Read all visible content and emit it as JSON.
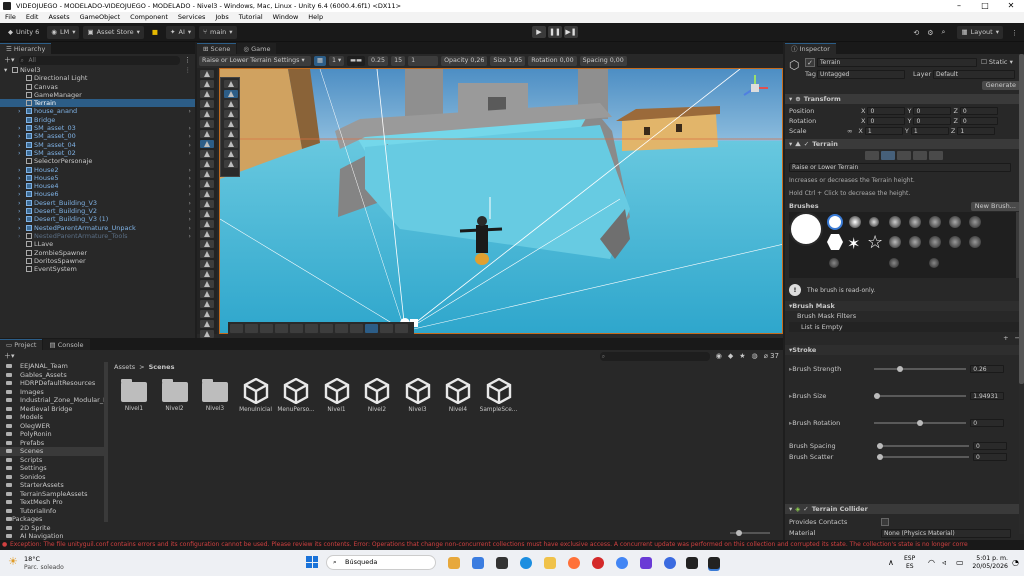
{
  "window": {
    "title": "VIDEOJUEGO - MODELADO-VIDEOJUEGO - MODELADO - Nivel3 - Windows, Mac, Linux - Unity 6.4 (6000.4.6f1) <DX11>"
  },
  "menu": [
    "File",
    "Edit",
    "Assets",
    "GameObject",
    "Component",
    "Services",
    "Jobs",
    "Tutorial",
    "Window",
    "Help"
  ],
  "toolbar": {
    "unity": "Unity 6",
    "account": "LM",
    "asset_store": "Asset Store",
    "ai": "AI",
    "branch": "main",
    "layout": "Layout"
  },
  "hierarchy": {
    "tab": "Hierarchy",
    "search_placeholder": "All",
    "scene_name": "Nivel3",
    "items": [
      {
        "label": "Directional Light",
        "kind": "normal",
        "indent": 2
      },
      {
        "label": "Canvas",
        "kind": "normal",
        "indent": 2
      },
      {
        "label": "GameManager",
        "kind": "normal",
        "indent": 2
      },
      {
        "label": "Terrain",
        "kind": "selected",
        "indent": 2
      },
      {
        "label": "house_anand",
        "kind": "blue",
        "indent": 2,
        "chev": true
      },
      {
        "label": "Bridge",
        "kind": "blue",
        "indent": 2
      },
      {
        "label": "SM_asset_03",
        "kind": "blue",
        "indent": 2,
        "chev": true
      },
      {
        "label": "SM_asset_00",
        "kind": "blue",
        "indent": 2,
        "chev": true
      },
      {
        "label": "SM_asset_04",
        "kind": "blue",
        "indent": 2,
        "chev": true
      },
      {
        "label": "SM_asset_02",
        "kind": "blue",
        "indent": 2,
        "chev": true
      },
      {
        "label": "SelectorPersonaje",
        "kind": "normal",
        "indent": 2
      },
      {
        "label": "House2",
        "kind": "blue",
        "indent": 2,
        "chev": true
      },
      {
        "label": "House5",
        "kind": "blue",
        "indent": 2,
        "chev": true
      },
      {
        "label": "House4",
        "kind": "blue",
        "indent": 2,
        "chev": true
      },
      {
        "label": "House6",
        "kind": "blue",
        "indent": 2,
        "chev": true
      },
      {
        "label": "Desert_Building_V3",
        "kind": "blue",
        "indent": 2,
        "chev": true
      },
      {
        "label": "Desert_Building_V2",
        "kind": "blue",
        "indent": 2,
        "chev": true
      },
      {
        "label": "Desert_Building_V3 (1)",
        "kind": "blue",
        "indent": 2,
        "chev": true
      },
      {
        "label": "NestedParentArmature_Unpack",
        "kind": "blue",
        "indent": 2,
        "chev": true
      },
      {
        "label": "NestedParentArmature_Tools",
        "kind": "faded",
        "indent": 2,
        "chev": true
      },
      {
        "label": "LLave",
        "kind": "normal",
        "indent": 2
      },
      {
        "label": "ZombieSpawner",
        "kind": "normal",
        "indent": 2
      },
      {
        "label": "DoritosSpawner",
        "kind": "normal",
        "indent": 2
      },
      {
        "label": "EventSystem",
        "kind": "normal",
        "indent": 2
      }
    ]
  },
  "scene": {
    "tabs": [
      "Scene",
      "Game"
    ],
    "mode": "Raise or Lower Terrain Settings",
    "layer_value": "1",
    "field1": "0.25",
    "field2": "15",
    "field3": "1",
    "opacity": "Opacity 0,26",
    "size": "Size 1,95",
    "rotation": "Rotation 0,00",
    "spacing": "Spacing 0,00"
  },
  "project": {
    "tabs": [
      "Project",
      "Console"
    ],
    "breadcrumb": [
      "Assets",
      "Scenes"
    ],
    "count": "37",
    "folders": [
      "EEJANAL_Team",
      "Gables_Assets",
      "HDRPDefaultResources",
      "Images",
      "Industrial_Zone_Modular_I",
      "Medieval Bridge",
      "Models",
      "OlegWER",
      "PolyRonin",
      "Prefabs",
      "Scenes",
      "Scripts",
      "Settings",
      "Sonidos",
      "StarterAssets",
      "TerrainSampleAssets",
      "TextMesh Pro",
      "TutorialInfo"
    ],
    "packages_label": "Packages",
    "packages": [
      "2D Sprite",
      "AI Navigation"
    ],
    "assets": [
      {
        "label": "Nivel1",
        "type": "folder"
      },
      {
        "label": "Nivel2",
        "type": "folder"
      },
      {
        "label": "Nivel3",
        "type": "folder"
      },
      {
        "label": "MenuInicial",
        "type": "unity"
      },
      {
        "label": "MenuPerso...",
        "type": "unity"
      },
      {
        "label": "Nivel1",
        "type": "unity"
      },
      {
        "label": "Nivel2",
        "type": "unity"
      },
      {
        "label": "Nivel3",
        "type": "unity"
      },
      {
        "label": "Nivel4",
        "type": "unity"
      },
      {
        "label": "SampleSce...",
        "type": "unity"
      }
    ]
  },
  "inspector": {
    "tab": "Inspector",
    "object_name": "Terrain",
    "static_label": "Static",
    "tag_label": "Tag",
    "tag_value": "Untagged",
    "layer_label": "Layer",
    "layer_value": "Default",
    "generate": "Generate",
    "transform": {
      "title": "Transform",
      "position_label": "Position",
      "rotation_label": "Rotation",
      "scale_label": "Scale",
      "position": [
        "0",
        "0",
        "0"
      ],
      "rotation": [
        "0",
        "0",
        "0"
      ],
      "scale": [
        "1",
        "1",
        "1"
      ]
    },
    "terrain": {
      "title": "Terrain",
      "tool": "Raise or Lower Terrain",
      "help1": "Increases or decreases the Terrain height.",
      "help2": "Hold Ctrl + Click to decrease the height.",
      "brushes_label": "Brushes",
      "new_brush": "New Brush...",
      "readonly": "The brush is read-only.",
      "brush_mask": "Brush Mask",
      "brush_mask_filters": "Brush Mask Filters",
      "list_empty": "List is Empty",
      "stroke": "Stroke",
      "brush_strength_label": "Brush Strength",
      "brush_strength": "0.26",
      "brush_size_label": "Brush Size",
      "brush_size": "1.94931",
      "brush_rotation_label": "Brush Rotation",
      "brush_rotation": "0",
      "brush_spacing_label": "Brush Spacing",
      "brush_spacing": "0",
      "brush_scatter_label": "Brush Scatter",
      "brush_scatter": "0"
    },
    "collider": {
      "title": "Terrain Collider",
      "provides_contacts": "Provides Contacts",
      "material_label": "Material",
      "material_value": "None (Physics Material)"
    }
  },
  "status": {
    "message": "Exception: The file unityguil.conf contains errors and its configuration cannot be used. Please review its contents. Error: Operations that change non-concurrent collections must have exclusive access. A concurrent update was performed on this collection and corrupted its state. The collection's state is no longer corre"
  },
  "taskbar": {
    "temp": "18°C",
    "weather": "Parc. soleado",
    "search": "Búsqueda",
    "lang1": "ESP",
    "lang2": "ES",
    "time": "5:01 p. m.",
    "date": "20/05/2026"
  }
}
